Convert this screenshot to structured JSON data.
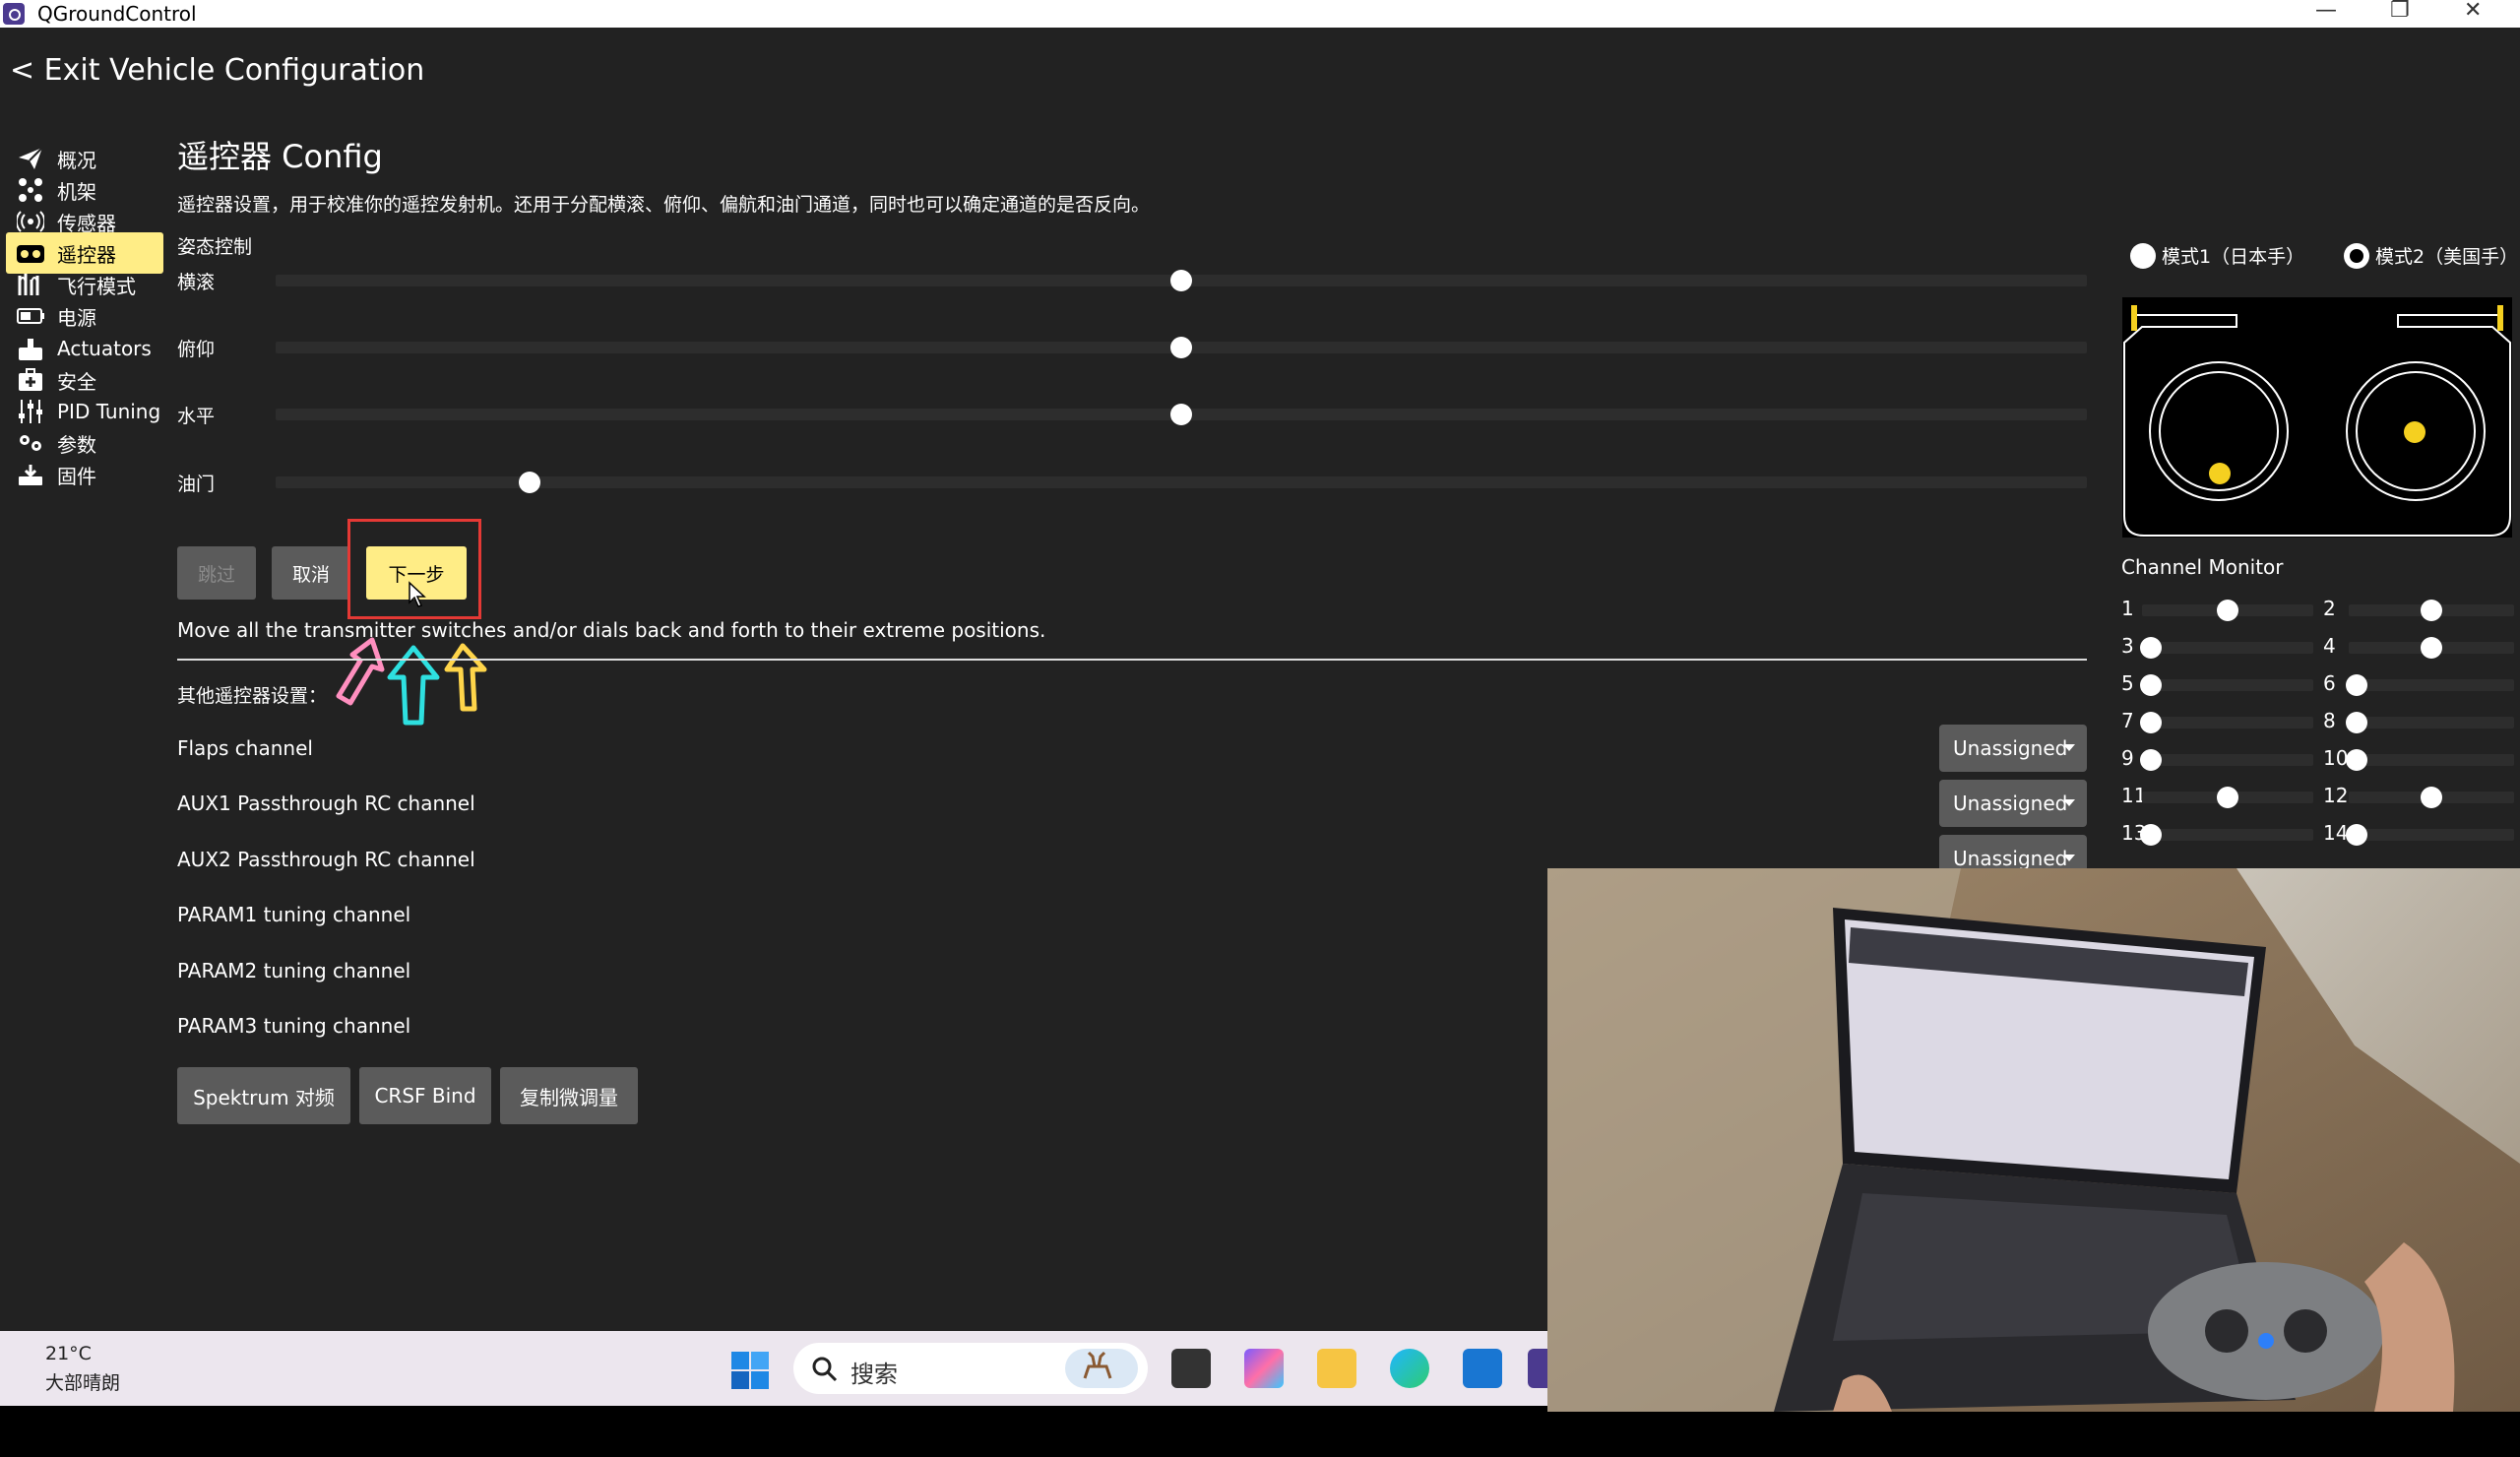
{
  "window": {
    "title": "QGroundControl",
    "minimize": "—",
    "restore": "❐",
    "close": "✕"
  },
  "exit_link": "< Exit Vehicle Configuration",
  "sidebar": {
    "items": [
      {
        "label": "概况",
        "icon": "paper-plane-icon"
      },
      {
        "label": "机架",
        "icon": "airframe-icon"
      },
      {
        "label": "传感器",
        "icon": "sensors-icon"
      },
      {
        "label": "遥控器",
        "icon": "radio-icon",
        "active": true
      },
      {
        "label": "飞行模式",
        "icon": "flight-modes-icon"
      },
      {
        "label": "电源",
        "icon": "battery-icon"
      },
      {
        "label": "Actuators",
        "icon": "actuators-icon"
      },
      {
        "label": "安全",
        "icon": "safety-icon"
      },
      {
        "label": "PID Tuning",
        "icon": "sliders-icon"
      },
      {
        "label": "参数",
        "icon": "parameters-icon"
      },
      {
        "label": "固件",
        "icon": "firmware-icon"
      }
    ]
  },
  "main": {
    "title": "遥控器 Config",
    "description": "遥控器设置，用于校准你的遥控发射机。还用于分配横滚、俯仰、偏航和油门通道，同时也可以确定通道的是否反向。",
    "attitude_label": "姿态控制",
    "axes": [
      {
        "label": "横滚",
        "value": 0.5
      },
      {
        "label": "俯仰",
        "value": 0.5
      },
      {
        "label": "水平",
        "value": 0.5
      },
      {
        "label": "油门",
        "value": 0.14
      }
    ],
    "buttons": {
      "skip": "跳过",
      "cancel": "取消",
      "next": "下一步"
    },
    "message": "Move all the transmitter switches and/or dials back and forth to their extreme positions.",
    "other_settings": "其他遥控器设置：",
    "channels": [
      {
        "label": "Flaps channel",
        "value": "Unassigned"
      },
      {
        "label": "AUX1 Passthrough RC channel",
        "value": "Unassigned"
      },
      {
        "label": "AUX2 Passthrough RC channel",
        "value": "Unassigned"
      },
      {
        "label": "PARAM1 tuning channel"
      },
      {
        "label": "PARAM2 tuning channel"
      },
      {
        "label": "PARAM3 tuning channel"
      }
    ],
    "bottom_buttons": {
      "spektrum": "Spektrum 对频",
      "crsf": "CRSF Bind",
      "copy_trims": "复制微调量"
    }
  },
  "right_panel": {
    "mode1": "模式1（日本手）",
    "mode2": "模式2（美国手）",
    "selected_mode": 2,
    "stick_color": "#f5d020",
    "channel_monitor_title": "Channel Monitor",
    "channels": [
      {
        "n": "1",
        "v": 0.5
      },
      {
        "n": "2",
        "v": 0.5
      },
      {
        "n": "3",
        "v": 0.05
      },
      {
        "n": "4",
        "v": 0.5
      },
      {
        "n": "5",
        "v": 0.05
      },
      {
        "n": "6",
        "v": 0.05
      },
      {
        "n": "7",
        "v": 0.05
      },
      {
        "n": "8",
        "v": 0.05
      },
      {
        "n": "9",
        "v": 0.05
      },
      {
        "n": "10",
        "v": 0.05
      },
      {
        "n": "11",
        "v": 0.5
      },
      {
        "n": "12",
        "v": 0.5
      },
      {
        "n": "13",
        "v": 0.05
      },
      {
        "n": "14",
        "v": 0.05
      }
    ]
  },
  "taskbar": {
    "temperature": "21°C",
    "weather": "大部晴朗",
    "search_label": "搜索"
  },
  "colors": {
    "accent": "#ffed86",
    "background": "#222222",
    "highlight_box": "#e53935"
  }
}
